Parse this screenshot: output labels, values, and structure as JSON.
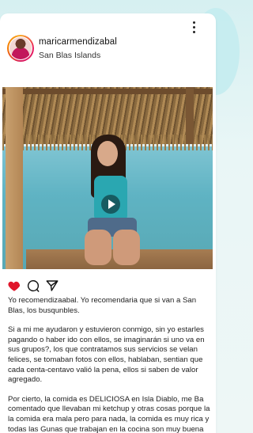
{
  "post": {
    "username": "maricarmendizabal",
    "location": "San Blas Islands",
    "caption": {
      "paragraph_1": "Yo recomendizaabal. Yo recomendaria que si van a San Blas, los busqunbles.",
      "paragraph_2": "Si a mi me ayudaron y estuvieron conmigo, sin yo estarles pagando o haber ido con ellos, se imaginarán si uno va en sus grupos?, los que contratamos sus servicios se velan felices, se tomaban fotos con ellos, hablaban, sentian que cada centa-centavo valió la pena, ellos si saben de valor agregado.",
      "paragraph_3": "Por cierto, la comida es DELICIOSA en Isla Diablo, me Ba comentado que llevaban mi ketchup y otras cosas porque la la comida era mala pero para nada, la comida es muy rica y todas las Gunas que trabajan en la cocina son muy buena gente."
    }
  },
  "icons": {
    "like": "heart-icon",
    "comment": "comment-icon",
    "share": "send-icon",
    "more": "more-vertical-icon",
    "play": "play-icon"
  },
  "colors": {
    "like_active": "#e0162b",
    "text": "#222222",
    "background": "#e3f4f5"
  }
}
